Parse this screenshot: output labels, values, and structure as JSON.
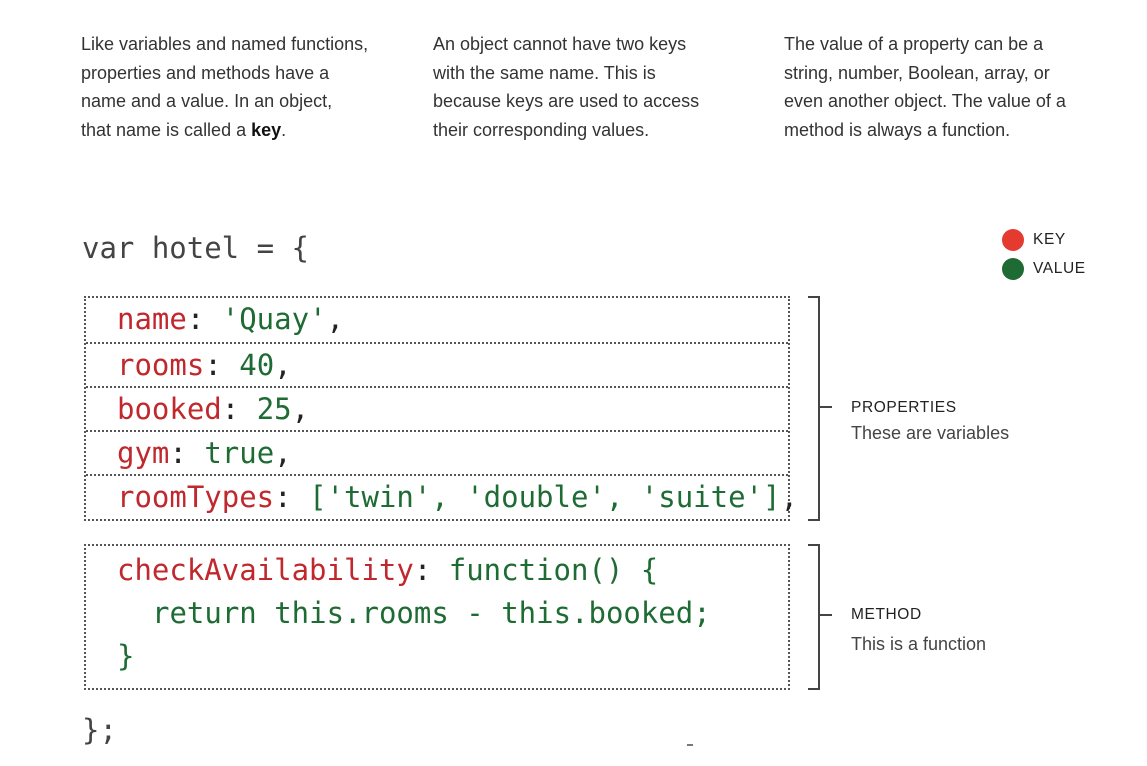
{
  "text": {
    "col1": {
      "lines": [
        "Like variables and named functions,",
        "properties and methods have a",
        "name and a value. In an object,"
      ],
      "last_prefix": "that name is called a ",
      "bold": "key",
      "last_suffix": "."
    },
    "col2": {
      "lines": [
        "An object cannot have two keys",
        "with the same name. This is",
        "because keys are used to access",
        "their corresponding values."
      ]
    },
    "col3": {
      "lines": [
        "The value of a property can be a",
        "string, number, Boolean, array, or",
        "even another object. The value of a",
        "method is always a function."
      ]
    }
  },
  "legend": {
    "key_label": "KEY",
    "value_label": "VALUE",
    "key_color": "#e53a2f",
    "value_color": "#1e6b33"
  },
  "code": {
    "open": {
      "var": "var hotel",
      "eq": " = ",
      "brace": "{"
    },
    "properties": [
      {
        "key": "name",
        "sep": ": ",
        "value": "'Quay'",
        "end": ","
      },
      {
        "key": "rooms",
        "sep": ": ",
        "value": "40",
        "end": ","
      },
      {
        "key": "booked",
        "sep": ": ",
        "value": "25",
        "end": ","
      },
      {
        "key": "gym",
        "sep": ": ",
        "value": "true",
        "end": ","
      },
      {
        "key": "roomTypes",
        "sep": ": ",
        "value": "['twin', 'double', 'suite']",
        "end": ","
      }
    ],
    "method": {
      "key": "checkAvailability",
      "sep": ": ",
      "value_line1": "function() {",
      "value_line2": "return this.rooms - this.booked;",
      "value_line3": "}"
    },
    "close": "};"
  },
  "annotations": {
    "properties": {
      "heading": "PROPERTIES",
      "sub": "These are variables"
    },
    "method": {
      "heading": "METHOD",
      "sub": "This is a function"
    }
  }
}
